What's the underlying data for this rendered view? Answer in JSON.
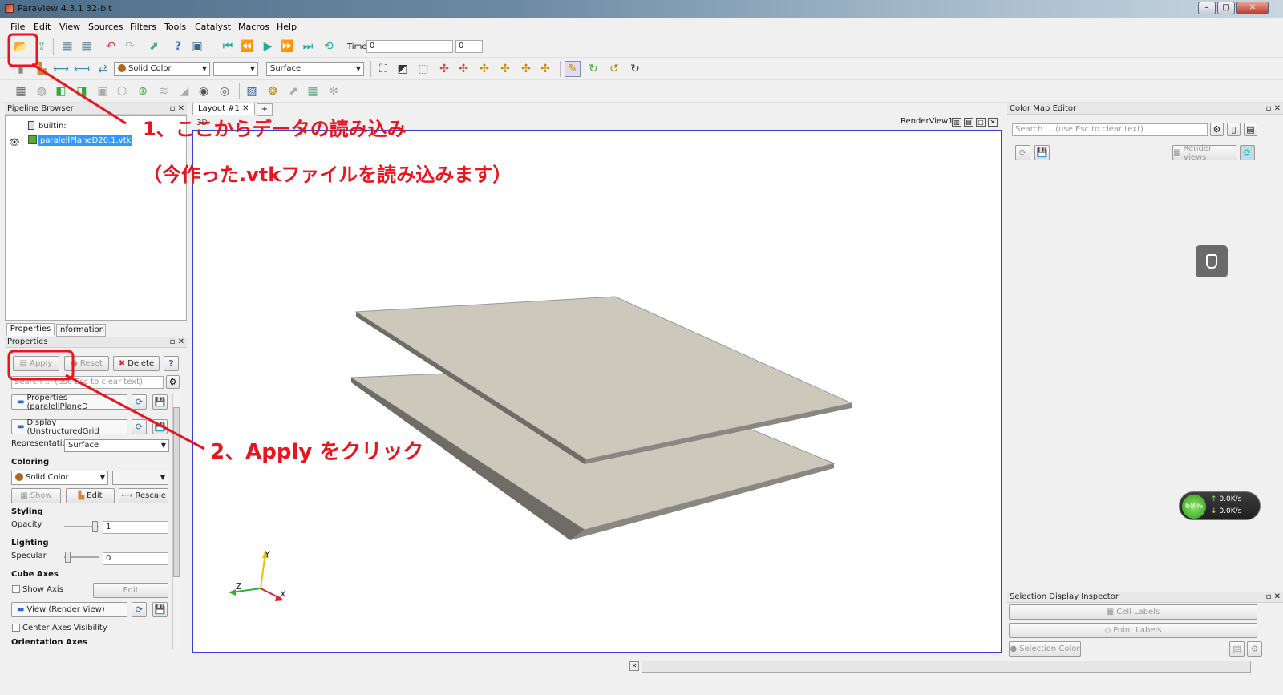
{
  "window": {
    "title": "ParaView 4.3.1 32-bit"
  },
  "menubar": [
    {
      "label": "File"
    },
    {
      "label": "Edit"
    },
    {
      "label": "View"
    },
    {
      "label": "Sources"
    },
    {
      "label": "Filters"
    },
    {
      "label": "Tools"
    },
    {
      "label": "Catalyst"
    },
    {
      "label": "Macros"
    },
    {
      "label": "Help"
    }
  ],
  "toolbar": {
    "time_label": "Time:",
    "time_value": "0",
    "timestep_value": "0",
    "color_combo": "Solid Color",
    "representation_combo": "Surface"
  },
  "pipeline": {
    "title": "Pipeline Browser",
    "items": [
      {
        "label": "builtin:"
      },
      {
        "label": "paralellPlaneD20.1.vtk"
      }
    ]
  },
  "prop_tabs": [
    {
      "label": "Properties"
    },
    {
      "label": "Information"
    }
  ],
  "properties": {
    "title": "Properties",
    "apply": "Apply",
    "reset": "Reset",
    "delete": "Delete",
    "help": "?",
    "search_placeholder": "Search ... (use Esc to clear text)",
    "section_props": "Properties (paralellPlaneD",
    "section_display": "Display (UnstructuredGrid",
    "representation_label": "Representation",
    "representation_value": "Surface",
    "coloring_header": "Coloring",
    "coloring_value": "Solid Color",
    "show": "Show",
    "edit": "Edit",
    "rescale": "Rescale",
    "styling_header": "Styling",
    "opacity_label": "Opacity",
    "opacity_value": "1",
    "lighting_header": "Lighting",
    "specular_label": "Specular",
    "specular_value": "0",
    "cubeaxes_header": "Cube Axes",
    "show_axis": "Show Axis",
    "cube_edit": "Edit",
    "section_view": "View (Render View)",
    "center_axes": "Center Axes Visibility",
    "orientation_header": "Orientation Axes"
  },
  "layout": {
    "tab": "Layout #1",
    "view_name": "RenderView1",
    "btn_3d": "3D"
  },
  "axes": {
    "y": "Y",
    "z": "Z",
    "x": "X"
  },
  "colormap": {
    "title": "Color Map Editor",
    "search_placeholder": "Search ... (use Esc to clear text)",
    "render_views": "Render Views"
  },
  "selection": {
    "title": "Selection Display Inspector",
    "cell_labels": "Cell Labels",
    "point_labels": "Point Labels",
    "selection_color": "Selection Color"
  },
  "netwidget": {
    "percent": "68%",
    "up": "0.0K/s",
    "down": "0.0K/s"
  },
  "annotations": {
    "step1": "1、ここからデータの読み込み",
    "step1_sub": "（今作った.vtkファイルを読み込みます）",
    "step2": "2、Apply をクリック"
  },
  "colors": {
    "annotation": "#e8141e",
    "plane": "#ccc8bc",
    "view_border": "#3a3cd6",
    "selection": "#3399ff"
  }
}
